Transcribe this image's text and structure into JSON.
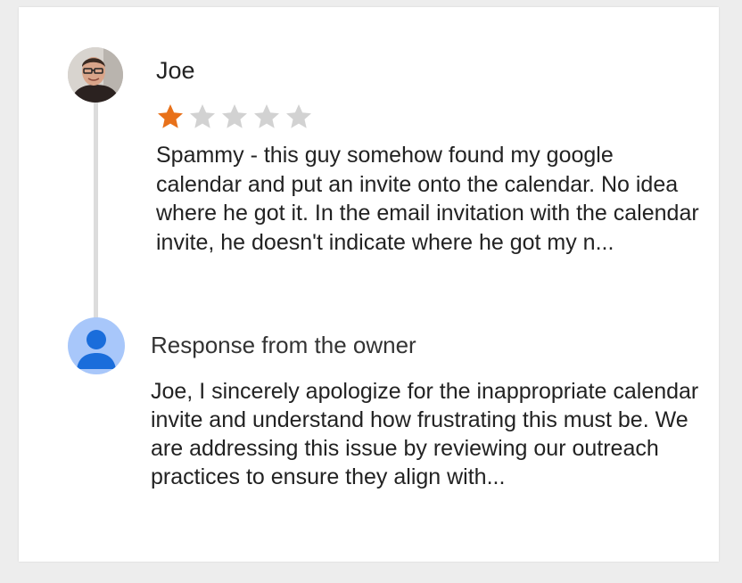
{
  "review": {
    "reviewer_name": "Joe",
    "rating": 1,
    "max_rating": 5,
    "text": "Spammy - this guy somehow found my google calendar and put an invite onto the calendar. No idea where he got it. In the email invitation with the calendar invite, he doesn't indicate where he got my n..."
  },
  "owner_response": {
    "title": "Response from the owner",
    "text": "Joe, I sincerely apologize for the inappropriate calendar invite and understand how frustrating this must be. We are addressing this issue by reviewing our outreach practices to ensure they align with..."
  },
  "colors": {
    "star_filled": "#e8711a",
    "star_empty": "#d2d2d2",
    "owner_avatar_bg": "#a8c7fa",
    "owner_avatar_fg": "#1a6ddb"
  }
}
